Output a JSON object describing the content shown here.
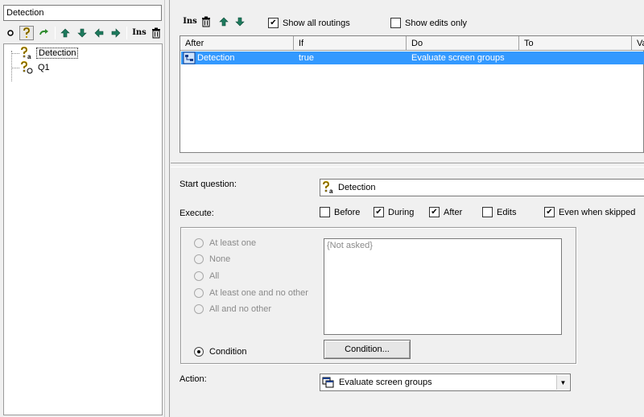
{
  "left_pane": {
    "node_name_value": "Detection",
    "toolbar": {
      "ins_label": "Ins"
    },
    "tree": [
      {
        "label": "Detection",
        "selected": true
      },
      {
        "label": "Q1",
        "selected": false
      }
    ]
  },
  "routing": {
    "toolbar": {
      "ins_label": "Ins"
    },
    "show_all_routings": {
      "label": "Show all routings",
      "checked": true
    },
    "show_edits_only": {
      "label": "Show edits only",
      "checked": false
    },
    "columns": [
      "After",
      "If",
      "Do",
      "To",
      "Va"
    ],
    "rows": [
      {
        "after": "Detection",
        "if": "true",
        "do": "Evaluate screen groups",
        "to": "",
        "va": ""
      }
    ]
  },
  "details": {
    "start_question_label": "Start question:",
    "start_question_value": "Detection",
    "execute_label": "Execute:",
    "execute_options": [
      {
        "label": "Before",
        "checked": false
      },
      {
        "label": "During",
        "checked": true
      },
      {
        "label": "After",
        "checked": true
      },
      {
        "label": "Edits",
        "checked": false
      },
      {
        "label": "Even when skipped",
        "checked": true
      }
    ],
    "radios": [
      {
        "label": "At least one",
        "selected": false,
        "enabled": false
      },
      {
        "label": "None",
        "selected": false,
        "enabled": false
      },
      {
        "label": "All",
        "selected": false,
        "enabled": false
      },
      {
        "label": "At least one and no other",
        "selected": false,
        "enabled": false
      },
      {
        "label": "All and no other",
        "selected": false,
        "enabled": false
      },
      {
        "label": "Condition",
        "selected": true,
        "enabled": true
      }
    ],
    "condition_text": "{Not asked}",
    "condition_button_label": "Condition...",
    "action_label": "Action:",
    "action_value": "Evaluate screen groups"
  }
}
